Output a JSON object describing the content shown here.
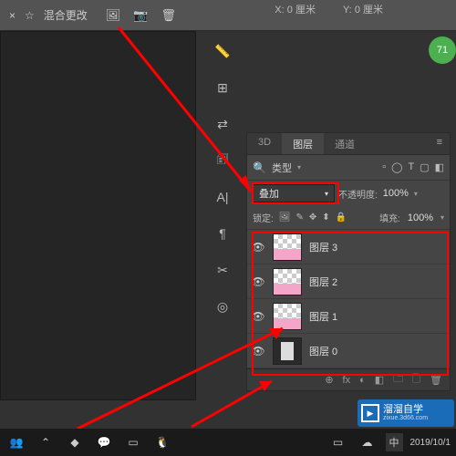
{
  "topbar": {
    "close_icon": "×",
    "favorite_icon": "☆",
    "title": "混合更改",
    "icons": [
      "🖼",
      "📷",
      "🗑"
    ]
  },
  "coords": {
    "x_label": "X:",
    "x_val": "0 厘米",
    "y_label": "Y:",
    "y_val": "0 厘米"
  },
  "vert_tools": [
    "📏",
    "⊞",
    "⇄",
    "🗊",
    "A|",
    "¶",
    "✂",
    "◎"
  ],
  "panel": {
    "tabs": [
      "3D",
      "图层",
      "通道"
    ],
    "active_tab": 1,
    "menu_icon": "≡",
    "search_icon": "🔍",
    "type_label": "类型",
    "filter_icons": [
      "▫",
      "◯",
      "T",
      "▢",
      "◧"
    ],
    "blend_mode": "叠加",
    "opacity_label": "不透明度:",
    "opacity_value": "100%",
    "lock_label": "锁定:",
    "lock_icons": [
      "🖼",
      "✎",
      "✥",
      "⬍",
      "🔒"
    ],
    "fill_label": "填充:",
    "fill_value": "100%",
    "layers": [
      {
        "visible": true,
        "name": "图层 3",
        "thumb": "pink"
      },
      {
        "visible": true,
        "name": "图层 2",
        "thumb": "pink"
      },
      {
        "visible": true,
        "name": "图层 1",
        "thumb": "pink"
      },
      {
        "visible": true,
        "name": "图层 0",
        "thumb": "photo"
      }
    ],
    "footer_icons": [
      "⊕",
      "fx",
      "◐",
      "◧",
      "🗀",
      "🗋",
      "🗑"
    ]
  },
  "green_badge": "71",
  "taskbar": {
    "left_icons": [
      "👥",
      "⌃",
      "◆",
      "💬",
      "▭",
      "🐧"
    ],
    "right_icons": [
      "▭",
      "☁"
    ],
    "ime": "中",
    "date": "2019/10/1"
  },
  "watermark": {
    "brand": "溜溜自学",
    "url": "zixue.3d66.com"
  }
}
